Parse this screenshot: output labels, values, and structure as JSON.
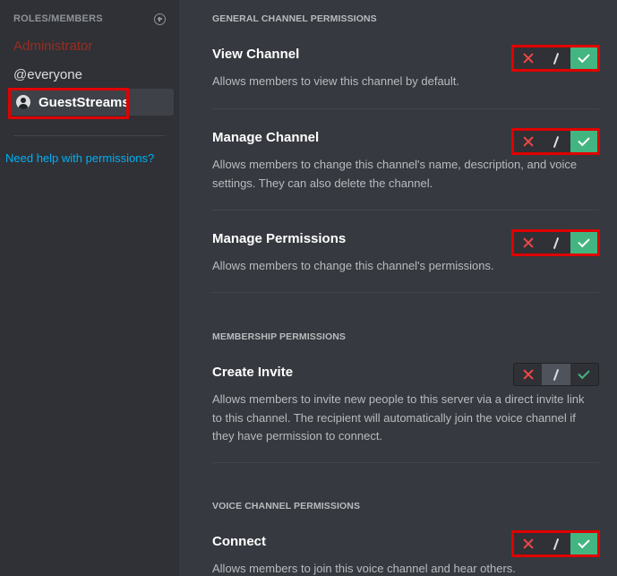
{
  "sidebar": {
    "title": "ROLES/MEMBERS",
    "add_icon": "plus-circle-icon",
    "roles": [
      {
        "label": "Administrator",
        "color": "#992d22"
      },
      {
        "label": "@everyone",
        "color": "#dcddde"
      },
      {
        "label": "GuestStreams",
        "color": "#ffffff",
        "selected": true,
        "icon": "member-avatar-icon"
      }
    ],
    "help_link": "Need help with permissions?"
  },
  "sections": {
    "general": "GENERAL CHANNEL PERMISSIONS",
    "membership": "MEMBERSHIP PERMISSIONS",
    "voice": "VOICE CHANNEL PERMISSIONS"
  },
  "permissions": {
    "view_channel": {
      "title": "View Channel",
      "description": "Allows members to view this channel by default.",
      "state": "allow"
    },
    "manage_channel": {
      "title": "Manage Channel",
      "description": "Allows members to change this channel's name, description, and voice settings. They can also delete the channel.",
      "state": "allow"
    },
    "manage_permissions": {
      "title": "Manage Permissions",
      "description": "Allows members to change this channel's permissions.",
      "state": "allow"
    },
    "create_invite": {
      "title": "Create Invite",
      "description": "Allows members to invite new people to this server via a direct invite link to this channel. The recipient will automatically join the voice channel if they have permission to connect.",
      "state": "neutral"
    },
    "connect": {
      "title": "Connect",
      "description": "Allows members to join this voice channel and hear others.",
      "state": "allow"
    }
  },
  "toggle_icons": [
    "deny-x-icon",
    "neutral-slash-icon",
    "allow-check-icon"
  ],
  "colors": {
    "deny": "#f04747",
    "allow": "#43b581",
    "link": "#00b0f4",
    "highlight": "#e00000"
  }
}
